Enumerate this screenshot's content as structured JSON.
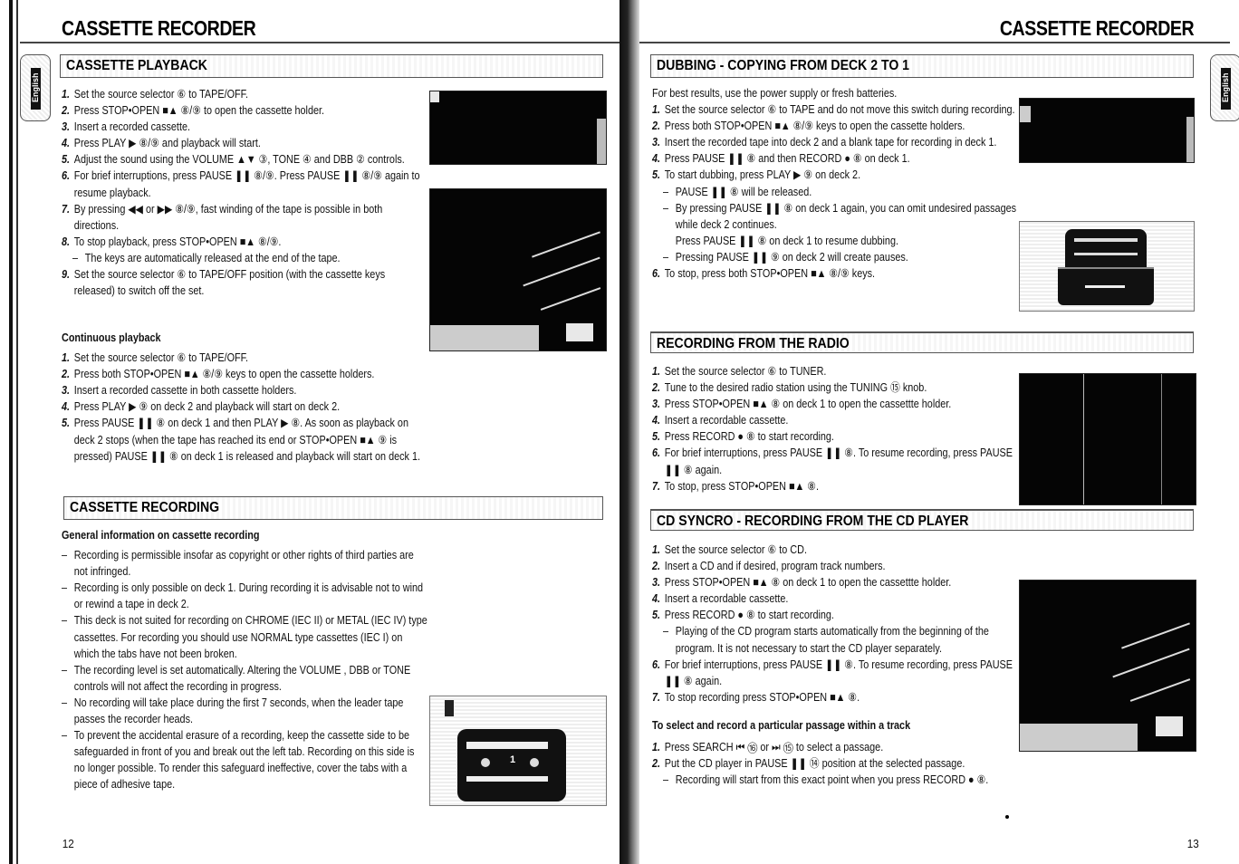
{
  "left_page": {
    "header_title": "CASSETTE RECORDER",
    "language_tab": "English",
    "page_number": "12",
    "playback": {
      "title": "CASSETTE PLAYBACK",
      "steps": [
        {
          "num": "1.",
          "text": "Set the source selector ⑥ to TAPE/OFF."
        },
        {
          "num": "2.",
          "text": "Press STOP•OPEN ■▲ ⑧/⑨ to open the cassette holder."
        },
        {
          "num": "3.",
          "text": "Insert a recorded cassette."
        },
        {
          "num": "4.",
          "text": "Press PLAY ▶ ⑧/⑨ and playback will start."
        },
        {
          "num": "5.",
          "text": "Adjust the sound using the VOLUME ▲▼ ③, TONE ④ and DBB ② controls."
        },
        {
          "num": "6.",
          "text": "For brief interruptions, press PAUSE ❚❚ ⑧/⑨. Press PAUSE ❚❚ ⑧/⑨ again to resume playback."
        },
        {
          "num": "7.",
          "text": "By pressing ◀◀ or ▶▶ ⑧/⑨, fast winding of the tape is possible in both directions."
        },
        {
          "num": "8.",
          "text": "To stop playback, press STOP•OPEN ■▲ ⑧/⑨."
        },
        {
          "num": "",
          "sub": true,
          "text": "The keys are automatically released at the end of the tape."
        },
        {
          "num": "9.",
          "text": "Set the source selector ⑥ to TAPE/OFF position (with the cassette keys released) to switch off the set."
        }
      ]
    },
    "continuous": {
      "title": "Continuous playback",
      "steps": [
        {
          "num": "1.",
          "text": "Set the source selector ⑥ to TAPE/OFF."
        },
        {
          "num": "2.",
          "text": "Press both STOP•OPEN ■▲ ⑧/⑨ keys to open the cassette holders."
        },
        {
          "num": "3.",
          "text": "Insert a recorded cassette in both cassette holders."
        },
        {
          "num": "4.",
          "text": "Press PLAY ▶ ⑨ on deck 2 and playback will start on deck 2."
        },
        {
          "num": "5.",
          "text": "Press PAUSE ❚❚ ⑧ on deck 1 and then PLAY ▶ ⑧. As soon as playback on deck 2 stops (when the tape has reached its end or STOP•OPEN ■▲ ⑨ is pressed) PAUSE ❚❚ ⑧ on deck 1 is released and playback will start on deck 1."
        }
      ]
    },
    "recording": {
      "title": "CASSETTE RECORDING",
      "general_title": "General information on cassette recording",
      "items": [
        "Recording is permissible insofar as copyright or other rights of third parties are not infringed.",
        "Recording is only possible on deck 1. During recording it is advisable not to wind or rewind a tape in deck 2.",
        "This deck is not suited for recording on CHROME (IEC II) or METAL (IEC IV) type cassettes. For recording you should use NORMAL type cassettes (IEC I) on which the tabs have not been broken.",
        "The recording level is set automatically. Altering the VOLUME , DBB or TONE controls will not affect the recording in progress.",
        "No recording will take place during the first 7 seconds, when the leader tape passes the recorder heads.",
        "To prevent the accidental erasure of a recording, keep the cassette side to be safeguarded in front of you and break out the left tab. Recording on this side is no longer possible. To render this safeguard ineffective, cover the tabs with a piece of adhesive tape."
      ]
    },
    "cassette_illustration_label": "1"
  },
  "right_page": {
    "header_title": "CASSETTE RECORDER",
    "language_tab": "English",
    "page_number": "13",
    "dubbing": {
      "title": "DUBBING - COPYING FROM DECK 2 TO 1",
      "intro": "For best results, use the power supply or fresh batteries.",
      "steps": [
        {
          "num": "1.",
          "text": "Set the source selector ⑥ to TAPE and do not move this switch during recording."
        },
        {
          "num": "2.",
          "text": "Press both STOP•OPEN ■▲ ⑧/⑨ keys to open the cassette holders."
        },
        {
          "num": "3.",
          "text": "Insert the recorded tape into deck 2 and a blank tape for recording in deck 1."
        },
        {
          "num": "4.",
          "text": "Press PAUSE ❚❚ ⑧ and then RECORD ● ⑧ on deck 1."
        },
        {
          "num": "5.",
          "text": "To start dubbing, press PLAY ▶ ⑨ on deck 2."
        },
        {
          "num": "",
          "sub": true,
          "text": "PAUSE ❚❚ ⑧ will be released."
        },
        {
          "num": "",
          "sub": true,
          "text": "By pressing PAUSE ❚❚ ⑧ on deck 1 again, you can omit undesired passages while deck 2 continues."
        },
        {
          "num": "",
          "sub": true,
          "nodash": true,
          "text": "Press PAUSE ❚❚ ⑧ on deck 1 to resume dubbing."
        },
        {
          "num": "",
          "sub": true,
          "text": "Pressing PAUSE ❚❚ ⑨ on deck 2 will create pauses."
        },
        {
          "num": "6.",
          "text": "To stop, press both STOP•OPEN ■▲ ⑧/⑨ keys."
        }
      ]
    },
    "radio": {
      "title": "RECORDING FROM THE RADIO",
      "steps": [
        {
          "num": "1.",
          "text": "Set the source selector ⑥ to TUNER."
        },
        {
          "num": "2.",
          "text": "Tune to the desired radio station using the TUNING ⑮ knob."
        },
        {
          "num": "3.",
          "text": "Press STOP•OPEN ■▲ ⑧ on deck 1 to open the cassettte holder."
        },
        {
          "num": "4.",
          "text": "Insert a recordable cassette."
        },
        {
          "num": "5.",
          "text": "Press RECORD ● ⑧ to start recording."
        },
        {
          "num": "6.",
          "text": "For brief interruptions, press PAUSE ❚❚ ⑧. To resume recording, press PAUSE ❚❚ ⑧ again."
        },
        {
          "num": "7.",
          "text": "To stop, press STOP•OPEN ■▲ ⑧."
        }
      ]
    },
    "cd_syncro": {
      "title": "CD SYNCRO - RECORDING FROM THE CD PLAYER",
      "steps": [
        {
          "num": "1.",
          "text": "Set the source selector ⑥ to CD."
        },
        {
          "num": "2.",
          "text": "Insert a CD and if desired, program track numbers."
        },
        {
          "num": "3.",
          "text": "Press STOP•OPEN ■▲ ⑧ on deck 1 to open the cassettte holder."
        },
        {
          "num": "4.",
          "text": "Insert a recordable cassette."
        },
        {
          "num": "5.",
          "text": "Press RECORD ● ⑧ to start recording."
        },
        {
          "num": "",
          "sub": true,
          "text": "Playing of the CD program starts automatically from the beginning of the program. It is not necessary to start the CD player separately."
        },
        {
          "num": "6.",
          "text": "For brief interruptions, press PAUSE ❚❚ ⑧. To resume recording, press PAUSE ❚❚ ⑧ again."
        },
        {
          "num": "7.",
          "text": "To stop recording press STOP•OPEN ■▲ ⑧."
        }
      ]
    },
    "passage": {
      "title": "To select and record a particular passage within a track",
      "steps": [
        {
          "num": "1.",
          "text": "Press SEARCH ⏮ ⑯ or ⏭ ⑮ to select a passage."
        },
        {
          "num": "2.",
          "text": "Put the CD player in PAUSE ❚❚ ⑭ position at the selected passage."
        },
        {
          "num": "",
          "sub": true,
          "text": "Recording will start from this exact point when you press RECORD ● ⑧."
        }
      ]
    }
  }
}
